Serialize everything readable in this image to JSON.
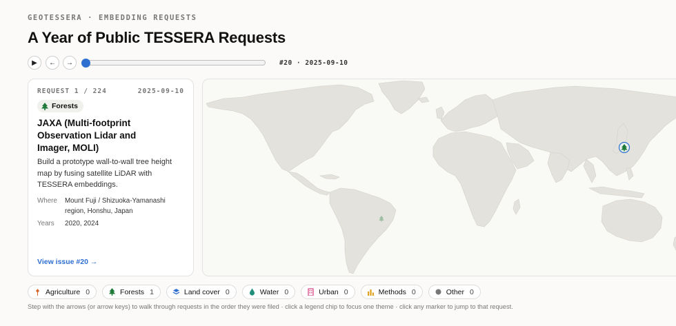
{
  "header": {
    "eyebrow": "GEOTESSERA · EMBEDDING REQUESTS",
    "title": "A Year of Public TESSERA Requests"
  },
  "controls": {
    "play_icon": "play-icon",
    "prev_icon": "arrow-left-icon",
    "next_icon": "arrow-right-icon",
    "slider_position": 0.0,
    "step_label": "#20 · 2025-09-10"
  },
  "card": {
    "counter": "REQUEST 1 / 224",
    "date": "2025-09-10",
    "theme": "Forests",
    "title": "JAXA (Multi-footprint Observation Lidar and Imager, MOLI)",
    "description": "Build a prototype wall-to-wall tree height map by fusing satellite LiDAR with TESSERA embeddings.",
    "where_label": "Where",
    "where_value": "Mount Fuji / Shizuoka-Yamanashi region, Honshu, Japan",
    "years_label": "Years",
    "years_value": "2020, 2024",
    "link": "View issue #20 →"
  },
  "map": {
    "markers": [
      {
        "theme": "Forests",
        "location": "Japan",
        "active": true
      },
      {
        "theme": "Forests",
        "location": "Brazil",
        "active": false
      }
    ]
  },
  "legend": [
    {
      "label": "Agriculture",
      "count": "0",
      "icon": "wheat-icon",
      "color": "#d9662b"
    },
    {
      "label": "Forests",
      "count": "1",
      "icon": "tree-icon",
      "color": "#1f7a3a"
    },
    {
      "label": "Land cover",
      "count": "0",
      "icon": "layers-icon",
      "color": "#2f6fd0"
    },
    {
      "label": "Water",
      "count": "0",
      "icon": "droplet-icon",
      "color": "#1f8f7a"
    },
    {
      "label": "Urban",
      "count": "0",
      "icon": "building-icon",
      "color": "#d94f8a"
    },
    {
      "label": "Methods",
      "count": "0",
      "icon": "bar-chart-icon",
      "color": "#e0a020"
    },
    {
      "label": "Other",
      "count": "0",
      "icon": "dot-icon",
      "color": "#777777"
    }
  ],
  "hint": "Step with the arrows (or arrow keys) to walk through requests in the order they were filed · click a legend chip to focus one theme · click any marker to jump to that request."
}
